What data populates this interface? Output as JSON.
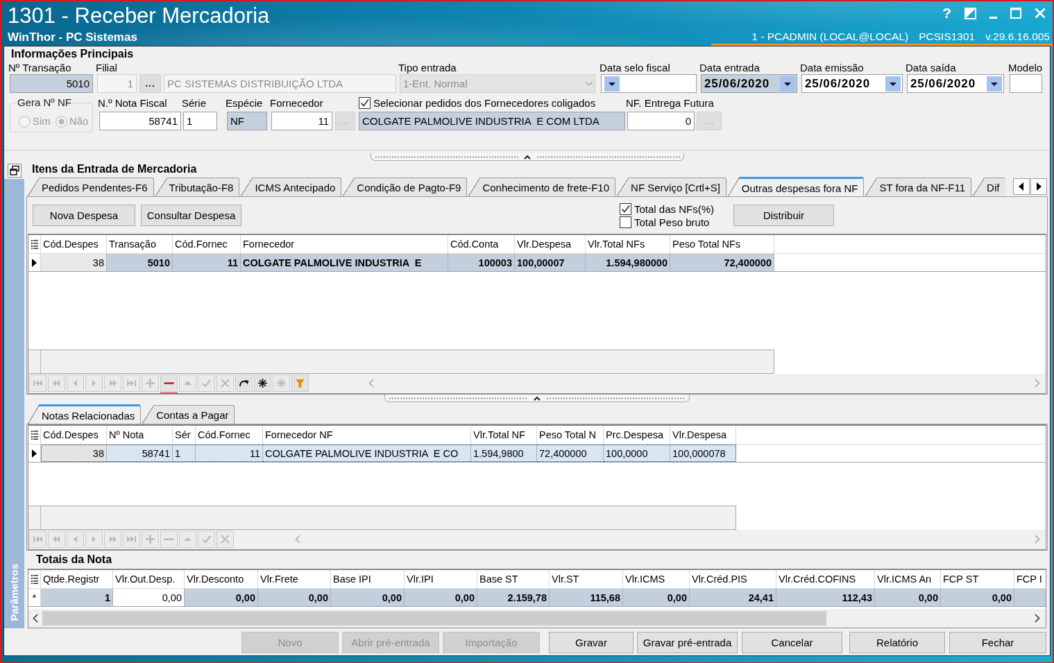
{
  "window": {
    "title": "1301 - Receber Mercadoria",
    "subtitle": "WinThor - PC Sistemas",
    "help_button": "?",
    "session": "1 - PCADMIN (LOCAL@LOCAL)",
    "program": "PCSIS1301",
    "version": "v.29.6.16.005"
  },
  "info": {
    "title": "Informações Principais",
    "transacao": {
      "label": "Nº Transação",
      "value": "5010",
      "readonly": true
    },
    "filial": {
      "label": "Filial",
      "code": "1",
      "lookup_button": "...",
      "lookup_disabled": false,
      "name": "PC SISTEMAS DISTRIBUIÇÃO LTDA",
      "disabled": true
    },
    "tipo_entrada": {
      "label": "Tipo entrada",
      "value": "1-Ent. Normal",
      "disabled": true
    },
    "dates": [
      {
        "label": "Data selo fiscal",
        "readonly": false
      },
      {
        "label": "Data entrada",
        "value": "25/06/2020",
        "readonly": true
      },
      {
        "label": "Data emissão",
        "value": "25/06/2020",
        "readonly": false
      },
      {
        "label": "Data saída",
        "value": "25/06/2020",
        "readonly": false
      }
    ],
    "modelo": {
      "label": "Modelo"
    },
    "gera_nf": {
      "title": "Gera Nº NF",
      "disabled": true,
      "options": [
        {
          "label": "Sim",
          "selected": false
        },
        {
          "label": "Não",
          "selected": true
        }
      ]
    },
    "nota_fiscal": {
      "label": "N.º Nota Fiscal",
      "value": "58741"
    },
    "serie": {
      "label": "Série",
      "value": "1"
    },
    "especie": {
      "label": "Espécie",
      "value": "NF",
      "readonly": true
    },
    "fornecedor": {
      "label": "Fornecedor",
      "code": "11",
      "lookup_button": "...",
      "lookup_disabled": true,
      "name": "COLGATE PALMOLIVE INDUSTRIA  E COM LTDA",
      "readonly": true
    },
    "coligados": {
      "label": "Selecionar pedidos dos Fornecedores coligados",
      "checked": true
    },
    "entrega_futura": {
      "label": "NF. Entrega Futura",
      "value": "0",
      "lookup_button": "...",
      "lookup_disabled": true
    }
  },
  "side_panel": {
    "label": "Parâmetros"
  },
  "items": {
    "title": "Itens da Entrada de Mercadoria",
    "tabs": [
      {
        "label": "Pedidos Pendentes-F6",
        "selected": false
      },
      {
        "label": "Tributação-F8",
        "selected": false
      },
      {
        "label": "ICMS Antecipado",
        "selected": false
      },
      {
        "label": "Condição de Pagto-F9",
        "selected": false
      },
      {
        "label": "Conhecimento de frete-F10",
        "selected": false
      },
      {
        "label": "NF Serviço [Crtl+S]",
        "selected": false
      },
      {
        "label": "Outras despesas fora NF",
        "selected": true
      },
      {
        "label": "ST fora da NF-F11",
        "selected": false
      },
      {
        "label": "Dif",
        "selected": false
      }
    ],
    "actions": [
      "Nova Despesa",
      "Consultar Despesa"
    ],
    "options": [
      {
        "label": "Total das NFs(%)",
        "checked": true
      },
      {
        "label": "Total Peso bruto",
        "checked": false
      }
    ],
    "distribute_button": "Distribuir",
    "grid": {
      "columns": [
        {
          "label": "Cód.Despes",
          "focused": true
        },
        {
          "label": "Transação",
          "focused": false
        },
        {
          "label": "Cód.Fornec",
          "focused": false
        },
        {
          "label": "Fornecedor",
          "focused": false
        },
        {
          "label": "Cód.Conta",
          "focused": false
        },
        {
          "label": "Vlr.Despesa",
          "focused": false
        },
        {
          "label": "Vlr.Total NFs",
          "focused": false
        },
        {
          "label": "Peso Total NFs",
          "focused": false
        }
      ],
      "rows": [
        {
          "selected": true,
          "cells": [
            "38",
            "5010",
            "11",
            "COLGATE PALMOLIVE INDUSTRIA  E",
            "100003",
            "100,00007",
            "1.594,980000",
            "72,400000"
          ]
        }
      ],
      "navigator": [
        {
          "kind": "first",
          "disabled": true,
          "highlighted": false
        },
        {
          "kind": "prior_page",
          "disabled": true,
          "highlighted": false
        },
        {
          "kind": "prior",
          "disabled": true,
          "highlighted": false
        },
        {
          "kind": "next",
          "disabled": true,
          "highlighted": false
        },
        {
          "kind": "next_page",
          "disabled": true,
          "highlighted": false
        },
        {
          "kind": "last",
          "disabled": true,
          "highlighted": false
        },
        {
          "kind": "insert",
          "disabled": true,
          "highlighted": false
        },
        {
          "kind": "delete",
          "disabled": false,
          "highlighted": true
        },
        {
          "kind": "edit",
          "disabled": true,
          "highlighted": false
        },
        {
          "kind": "post",
          "disabled": true,
          "highlighted": false
        },
        {
          "kind": "cancel",
          "disabled": true,
          "highlighted": false
        },
        {
          "kind": "refresh",
          "disabled": false,
          "highlighted": false
        },
        {
          "kind": "mark",
          "disabled": false,
          "highlighted": false
        },
        {
          "kind": "mark",
          "disabled": true,
          "highlighted": false
        },
        {
          "kind": "filter",
          "disabled": false,
          "highlighted": false
        }
      ]
    }
  },
  "notes": {
    "tabs": [
      {
        "label": "Notas Relacionadas",
        "selected": true
      },
      {
        "label": "Contas a Pagar",
        "selected": false
      }
    ],
    "grid": {
      "columns": [
        {
          "label": "Cód.Despes",
          "focused": true
        },
        {
          "label": "Nº Nota",
          "focused": false
        },
        {
          "label": "Sér",
          "focused": false
        },
        {
          "label": "Cód.Fornec",
          "focused": false
        },
        {
          "label": "Fornecedor NF",
          "focused": false
        },
        {
          "label": "Vlr.Total NF",
          "focused": false
        },
        {
          "label": "Peso Total N",
          "focused": false
        },
        {
          "label": "Prc.Despesa",
          "focused": false
        },
        {
          "label": "Vlr.Despesa",
          "focused": false
        }
      ],
      "rows": [
        {
          "selected": true,
          "cells": [
            "38",
            "58741",
            "1",
            "11",
            "COLGATE PALMOLIVE INDUSTRIA  E CO",
            "1.594,9800",
            "72,400000",
            "100,0000",
            "100,000078"
          ]
        }
      ],
      "navigator": [
        {
          "kind": "first",
          "disabled": true,
          "highlighted": false
        },
        {
          "kind": "prior_page",
          "disabled": true,
          "highlighted": false
        },
        {
          "kind": "prior",
          "disabled": true,
          "highlighted": false
        },
        {
          "kind": "next",
          "disabled": true,
          "highlighted": false
        },
        {
          "kind": "next_page",
          "disabled": true,
          "highlighted": false
        },
        {
          "kind": "last",
          "disabled": true,
          "highlighted": false
        },
        {
          "kind": "insert",
          "disabled": true,
          "highlighted": false
        },
        {
          "kind": "delete",
          "disabled": true,
          "highlighted": false
        },
        {
          "kind": "edit",
          "disabled": true,
          "highlighted": false
        },
        {
          "kind": "post",
          "disabled": true,
          "highlighted": false
        },
        {
          "kind": "cancel",
          "disabled": true,
          "highlighted": false
        }
      ]
    }
  },
  "totals": {
    "title": "Totais da Nota",
    "grid": {
      "columns": [
        {
          "label": "Qtde.Registr",
          "focused": false
        },
        {
          "label": "Vlr.Out.Desp.",
          "focused": true
        },
        {
          "label": "Vlr.Desconto",
          "focused": false
        },
        {
          "label": "Vlr.Frete",
          "focused": false
        },
        {
          "label": "Base IPI",
          "focused": false
        },
        {
          "label": "Vlr.IPI",
          "focused": false
        },
        {
          "label": "Base ST",
          "focused": false
        },
        {
          "label": "Vlr.ST",
          "focused": false
        },
        {
          "label": "Vlr.ICMS",
          "focused": false
        },
        {
          "label": "Vlr.Créd.PIS",
          "focused": false
        },
        {
          "label": "Vlr.Créd.COFINS",
          "focused": false
        },
        {
          "label": "Vlr.ICMS An",
          "focused": false
        },
        {
          "label": "FCP ST",
          "focused": false
        },
        {
          "label": "FCP I",
          "focused": false
        }
      ],
      "rows": [
        {
          "selected": true,
          "indicator": "*",
          "cells": [
            "1",
            "0,00",
            "0,00",
            "0,00",
            "0,00",
            "0,00",
            "2.159,78",
            "115,68",
            "0,00",
            "24,41",
            "112,43",
            "0,00",
            "0,00"
          ]
        }
      ]
    }
  },
  "buttons": [
    {
      "label": "Novo",
      "disabled": true
    },
    {
      "label": "Abrir pré-entrada",
      "disabled": true
    },
    {
      "label": "Importação",
      "disabled": true
    },
    {
      "label": "Gravar",
      "disabled": false
    },
    {
      "label": "Gravar pré-entrada",
      "disabled": false
    },
    {
      "label": "Cancelar",
      "disabled": false
    },
    {
      "label": "Relatório",
      "disabled": false
    },
    {
      "label": "Fechar",
      "disabled": false
    }
  ]
}
